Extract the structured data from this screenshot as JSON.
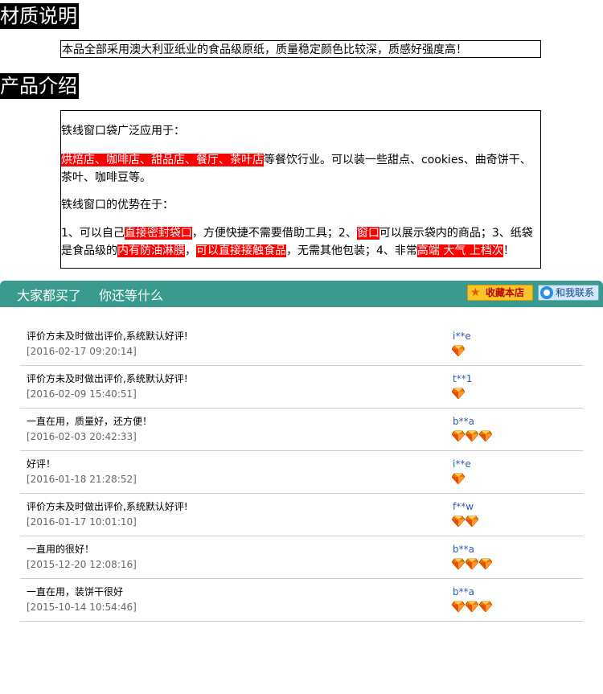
{
  "sections": {
    "material_title": "材质说明",
    "intro_title": "产品介绍"
  },
  "material": {
    "text": "本品全部采用澳大利亚纸业的食品级原纸，质量稳定颜色比较深，质感好强度高！"
  },
  "intro": {
    "p1": "铁线窗口袋广泛应用于：",
    "p2_hl": "烘焙店、咖啡店、甜品店、餐厅、茶叶店",
    "p2_rest": "等餐饮行业。可以装一些甜点、cookies、曲奇饼干、茶叶、咖啡豆等。",
    "p3": "铁线窗口的优势在于：",
    "p4_a": "1、可以自己",
    "p4_hl1": "直接密封袋口",
    "p4_b": "，方便快捷不需要借助工具；2、",
    "p4_hl2": "窗口",
    "p4_c": "可以展示袋内的商品；3、纸袋是食品级的",
    "p4_hl3": "内有防油淋膜",
    "p4_d": "，",
    "p4_hl4": "可以直接接触食品",
    "p4_e": "，无需其他包装；4、非常",
    "p4_hl5": "高端 大气 上档次",
    "p4_f": "！"
  },
  "bar": {
    "left_text": "大家都买了",
    "right_text": "你还等什么",
    "favorite_label": "收藏本店",
    "contact_label": "和我联系",
    "color": "#3a9a8d"
  },
  "reviews": [
    {
      "text": "评价方未及时做出评价,系统默认好评!",
      "time": "[2016-02-17 09:20:14]",
      "user": "i**e",
      "gems": 1
    },
    {
      "text": "评价方未及时做出评价,系统默认好评!",
      "time": "[2016-02-09 15:40:51]",
      "user": "t**1",
      "gems": 1
    },
    {
      "text": "一直在用，质量好，还方便！",
      "time": "[2016-02-03 20:42:33]",
      "user": "b**a",
      "gems": 3
    },
    {
      "text": "好评！",
      "time": "[2016-01-18 21:28:52]",
      "user": "i**e",
      "gems": 1
    },
    {
      "text": "评价方未及时做出评价,系统默认好评!",
      "time": "[2016-01-17 10:01:10]",
      "user": "f**w",
      "gems": 2
    },
    {
      "text": "一直用的很好！",
      "time": "[2015-12-20 12:08:16]",
      "user": "b**a",
      "gems": 3
    },
    {
      "text": "一直在用，装饼干很好",
      "time": "[2015-10-14 10:54:46]",
      "user": "b**a",
      "gems": 3
    }
  ]
}
